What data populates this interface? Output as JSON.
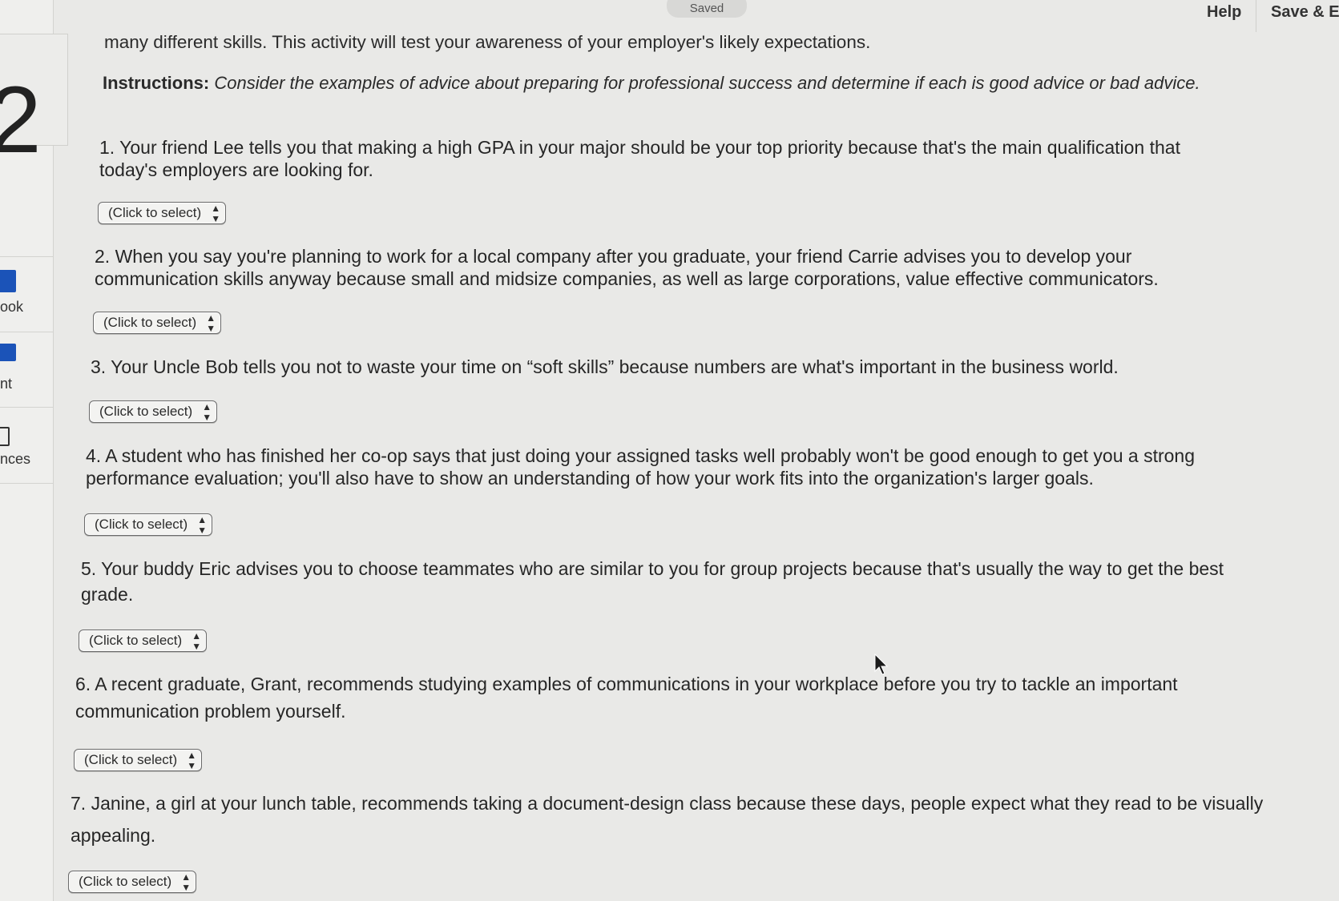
{
  "header": {
    "status_pill": "Saved",
    "help_label": "Help",
    "save_exit_label": "Save & Ex"
  },
  "sidebar": {
    "question_number": "2",
    "items": [
      {
        "label": "ook",
        "icon": "book-icon"
      },
      {
        "label": "nt",
        "icon": "print-icon"
      },
      {
        "label": "nces",
        "icon": "references-icon"
      }
    ]
  },
  "intro": {
    "text": "many different skills. This activity will test your awareness of your employer's likely expectations."
  },
  "instructions": {
    "label": "Instructions:",
    "text": "Consider the examples of advice about preparing for professional success and determine if each is good advice or bad advice."
  },
  "questions": [
    {
      "text": "1. Your friend Lee tells you that making a high GPA in your major should be your top priority because that's the main qualification that today's employers are looking for.",
      "select": "(Click to select)"
    },
    {
      "text": "2. When you say you're planning to work for a local company after you graduate, your friend Carrie advises you to develop your communication skills anyway because small and midsize companies, as well as large corporations, value effective communicators.",
      "select": "(Click to select)"
    },
    {
      "text": "3. Your Uncle Bob tells you not to waste your time on “soft skills” because numbers are what's important in the business world.",
      "select": "(Click to select)"
    },
    {
      "text": "4. A student who has finished her co-op says that just doing your assigned tasks well probably won't be good enough to get you a strong performance evaluation; you'll also have to show an understanding of how your work fits into the organization's larger goals.",
      "select": "(Click to select)"
    },
    {
      "text": "5. Your buddy Eric advises you to choose teammates who are similar to you for group projects because that's usually the way to get the best grade.",
      "select": "(Click to select)"
    },
    {
      "text": "6. A recent graduate, Grant, recommends studying examples of communications in your workplace before you try to tackle an important communication problem yourself.",
      "select": "(Click to select)"
    },
    {
      "text": "7. Janine, a girl at your lunch table, recommends taking a document-design class because these days, people expect what they read to be visually appealing.",
      "select": "(Click to select)"
    }
  ],
  "colors": {
    "accent": "#1b53b8",
    "background": "#e9e9e7"
  }
}
